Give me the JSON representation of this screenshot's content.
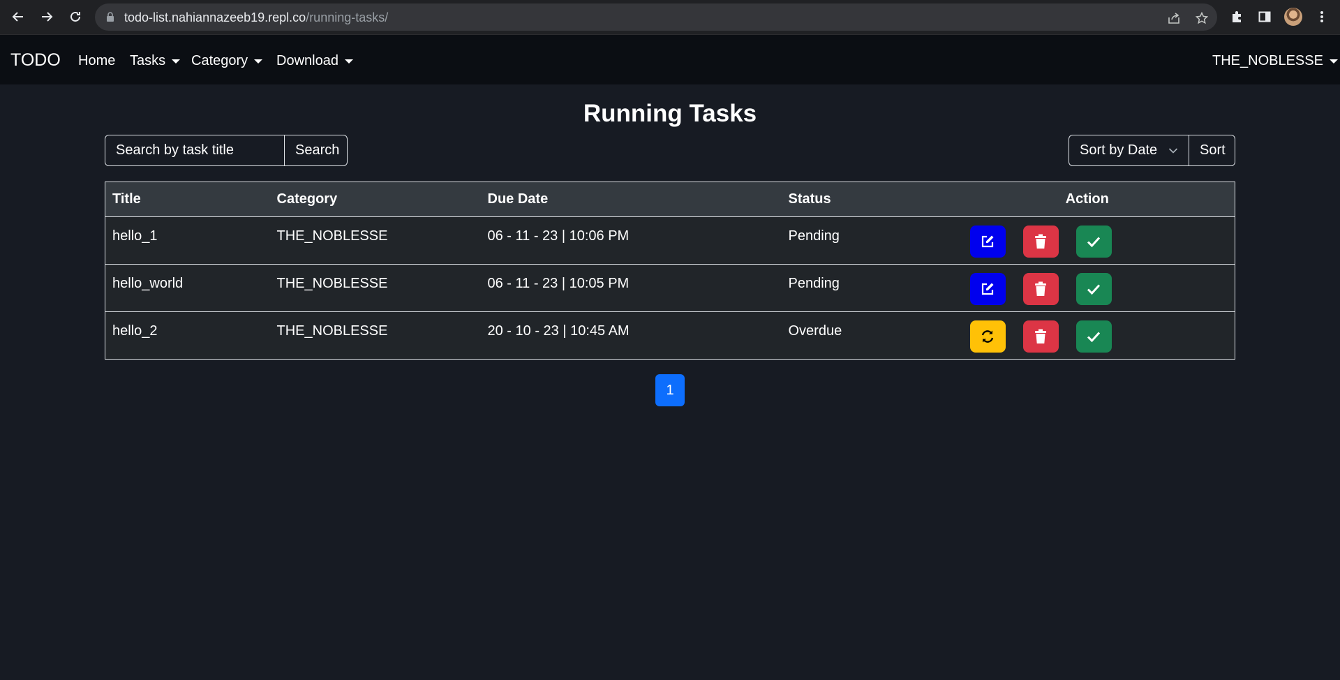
{
  "browser": {
    "url_host": "todo-list.nahiannazeeb19.repl.co",
    "url_path": "/running-tasks/"
  },
  "navbar": {
    "brand": "TODO",
    "links": [
      {
        "label": "Home",
        "dropdown": false
      },
      {
        "label": "Tasks",
        "dropdown": true
      },
      {
        "label": "Category",
        "dropdown": true
      },
      {
        "label": "Download",
        "dropdown": true
      }
    ],
    "user": "THE_NOBLESSE"
  },
  "main": {
    "title": "Running Tasks",
    "search": {
      "placeholder": "Search by task title",
      "button": "Search"
    },
    "sort": {
      "selected": "Sort by Date",
      "button": "Sort"
    },
    "table": {
      "headers": [
        "Title",
        "Category",
        "Due Date",
        "Status",
        "Action"
      ],
      "rows": [
        {
          "title": "hello_1",
          "category": "THE_NOBLESSE",
          "due": "06 - 11 - 23 | 10:06 PM",
          "status": "Pending",
          "primary_action": "edit-icon"
        },
        {
          "title": "hello_world",
          "category": "THE_NOBLESSE",
          "due": "06 - 11 - 23 | 10:05 PM",
          "status": "Pending",
          "primary_action": "edit-icon"
        },
        {
          "title": "hello_2",
          "category": "THE_NOBLESSE",
          "due": "20 - 10 - 23 | 10:45 AM",
          "status": "Overdue",
          "primary_action": "refresh-icon"
        }
      ]
    },
    "pagination": {
      "current": "1"
    }
  },
  "colors": {
    "page_bg": "#171b23",
    "navbar_bg": "#0b0e13",
    "edit": "#0000ee",
    "delete": "#dc3545",
    "done": "#198754",
    "reschedule": "#ffc107",
    "page_active": "#0d6efd"
  }
}
